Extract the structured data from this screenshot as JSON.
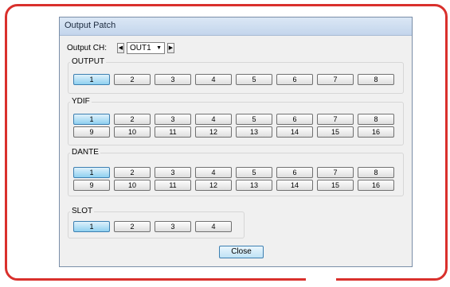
{
  "dialog": {
    "title": "Output Patch",
    "output_ch_label": "Output CH:",
    "output_ch_value": "OUT1",
    "prev_arrow": "◀",
    "next_arrow": "▶",
    "caret": "▼",
    "close_label": "Close"
  },
  "groups": {
    "output": {
      "label": "OUTPUT",
      "buttons": [
        "1",
        "2",
        "3",
        "4",
        "5",
        "6",
        "7",
        "8"
      ],
      "selected": "1"
    },
    "ydif": {
      "label": "YDIF",
      "buttons": [
        "1",
        "2",
        "3",
        "4",
        "5",
        "6",
        "7",
        "8",
        "9",
        "10",
        "11",
        "12",
        "13",
        "14",
        "15",
        "16"
      ],
      "selected": "1"
    },
    "dante": {
      "label": "DANTE",
      "buttons": [
        "1",
        "2",
        "3",
        "4",
        "5",
        "6",
        "7",
        "8",
        "9",
        "10",
        "11",
        "12",
        "13",
        "14",
        "15",
        "16"
      ],
      "selected": "1"
    },
    "slot": {
      "label": "SLOT",
      "buttons": [
        "1",
        "2",
        "3",
        "4"
      ],
      "selected": "1"
    }
  },
  "colors": {
    "frame": "#d9302c",
    "selected_button": "#8fd0f0"
  }
}
